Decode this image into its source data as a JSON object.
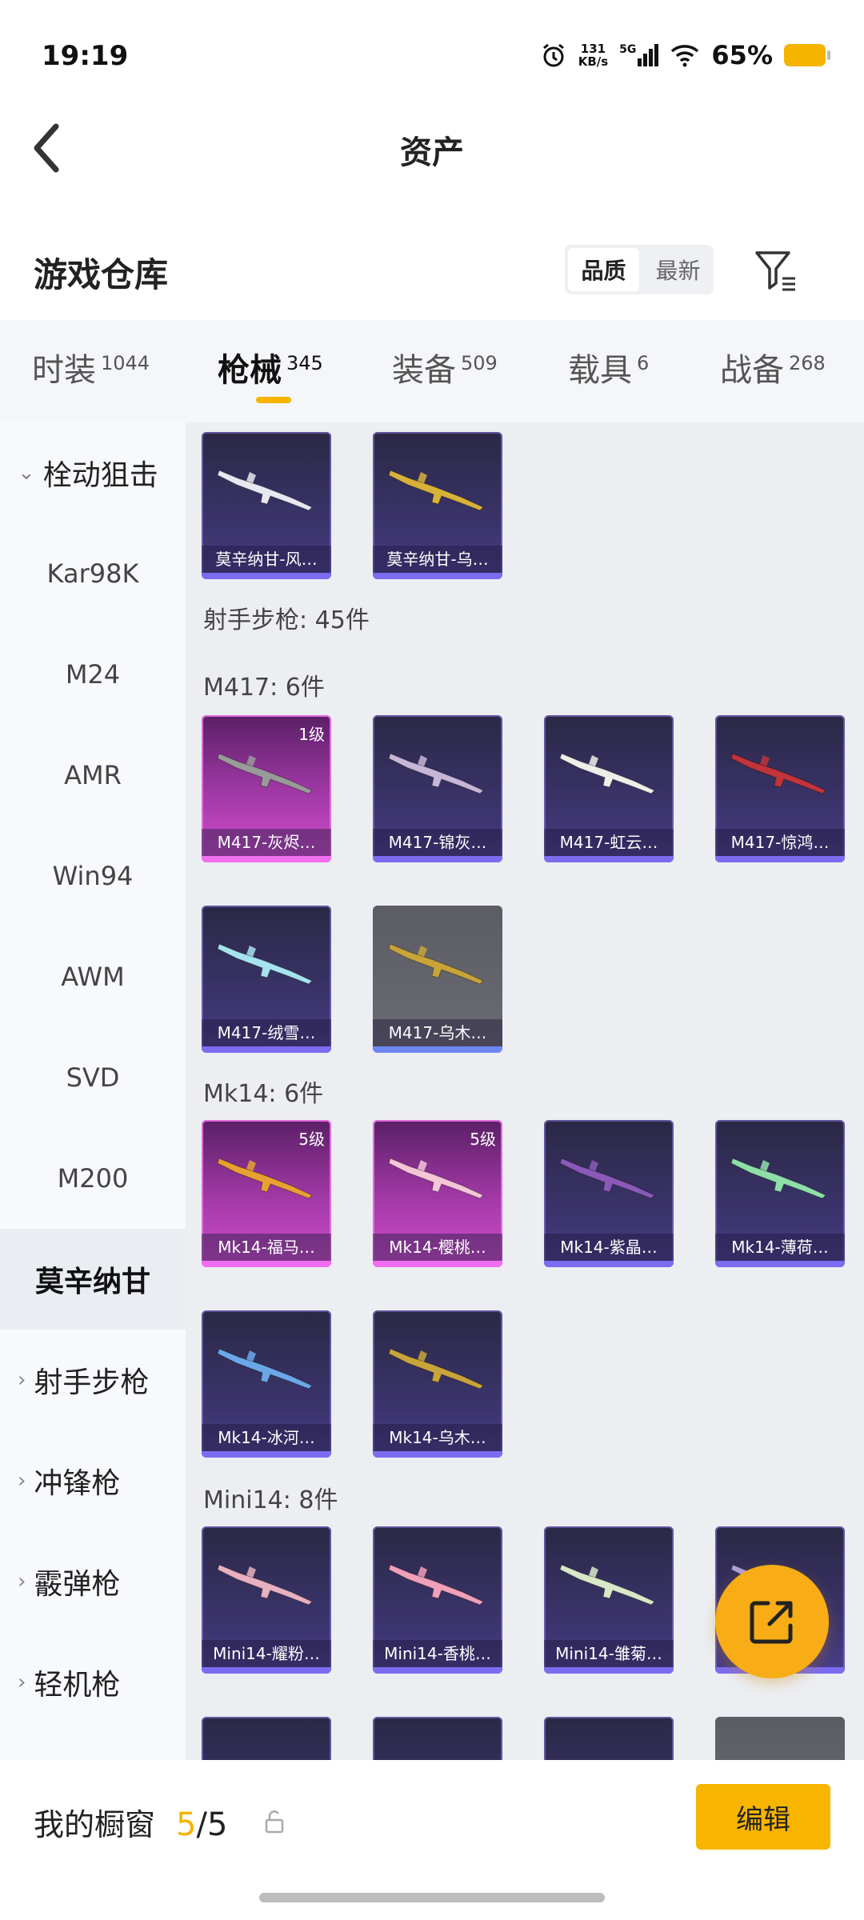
{
  "status_bar": {
    "time": "19:19",
    "net_speed": "131",
    "net_unit": "KB/s",
    "network": "5G",
    "battery": "65%",
    "battery_color": "#f5b400"
  },
  "header": {
    "title": "资产"
  },
  "warehouse": {
    "title": "游戏仓库",
    "sort_options": [
      "品质",
      "最新"
    ],
    "active_sort": "品质"
  },
  "tabs": [
    {
      "label": "时装",
      "count": "1044"
    },
    {
      "label": "枪械",
      "count": "345"
    },
    {
      "label": "装备",
      "count": "509"
    },
    {
      "label": "载具",
      "count": "6"
    },
    {
      "label": "战备",
      "count": "268"
    }
  ],
  "active_tab": "枪械",
  "sidebar": {
    "category_open": "栓动狙击",
    "items": [
      "Kar98K",
      "M24",
      "AMR",
      "Win94",
      "AWM",
      "SVD",
      "M200",
      "莫辛纳甘"
    ],
    "selected": "莫辛纳甘",
    "categories": [
      "射手步枪",
      "冲锋枪",
      "霰弹枪",
      "轻机枪"
    ]
  },
  "content": {
    "top_cards": [
      {
        "name": "莫辛纳甘-风…",
        "style": "blue",
        "gun_color": "#e8e8f0"
      },
      {
        "name": "莫辛纳甘-乌…",
        "style": "blue",
        "gun_color": "#d8b13a"
      }
    ],
    "marksman_summary": "射手步枪: 45件",
    "sections": [
      {
        "title": "M417: 6件",
        "cards": [
          {
            "name": "M417-灰烬…",
            "style": "pink",
            "level": "1级",
            "gun_color": "#9a9a9a"
          },
          {
            "name": "M417-锦灰…",
            "style": "blue",
            "gun_color": "#c8b6d8"
          },
          {
            "name": "M417-虹云…",
            "style": "blue",
            "gun_color": "#f0eee8"
          },
          {
            "name": "M417-惊鸿…",
            "style": "blue",
            "gun_color": "#c0343a"
          },
          {
            "name": "M417-绒雪…",
            "style": "blue",
            "gun_color": "#a6e3ee"
          },
          {
            "name": "M417-乌木…",
            "style": "gray",
            "gun_color": "#c9a43a"
          }
        ]
      },
      {
        "title": "Mk14: 6件",
        "cards": [
          {
            "name": "Mk14-福马…",
            "style": "pink",
            "level": "5级",
            "gun_color": "#e8a032"
          },
          {
            "name": "Mk14-樱桃…",
            "style": "pink",
            "level": "5级",
            "gun_color": "#f4c6d8"
          },
          {
            "name": "Mk14-紫晶…",
            "style": "blue",
            "gun_color": "#8a5ab8"
          },
          {
            "name": "Mk14-薄荷…",
            "style": "blue",
            "gun_color": "#8fe0a8"
          },
          {
            "name": "Mk14-冰河…",
            "style": "blue",
            "gun_color": "#6aa8e8"
          },
          {
            "name": "Mk14-乌木…",
            "style": "blue",
            "gun_color": "#c9a43a"
          }
        ]
      },
      {
        "title": "Mini14: 8件",
        "cards": [
          {
            "name": "Mini14-耀粉…",
            "style": "blue",
            "gun_color": "#e8b0c0"
          },
          {
            "name": "Mini14-香桃…",
            "style": "blue",
            "gun_color": "#f0a0b8"
          },
          {
            "name": "Mini14-雏菊…",
            "style": "blue",
            "gun_color": "#d8e8c8"
          },
          {
            "name": "",
            "style": "blue",
            "gun_color": "#b0a0e0"
          }
        ]
      }
    ]
  },
  "bottom_bar": {
    "label": "我的橱窗",
    "current": "5",
    "total": "/5",
    "edit_label": "编辑"
  }
}
